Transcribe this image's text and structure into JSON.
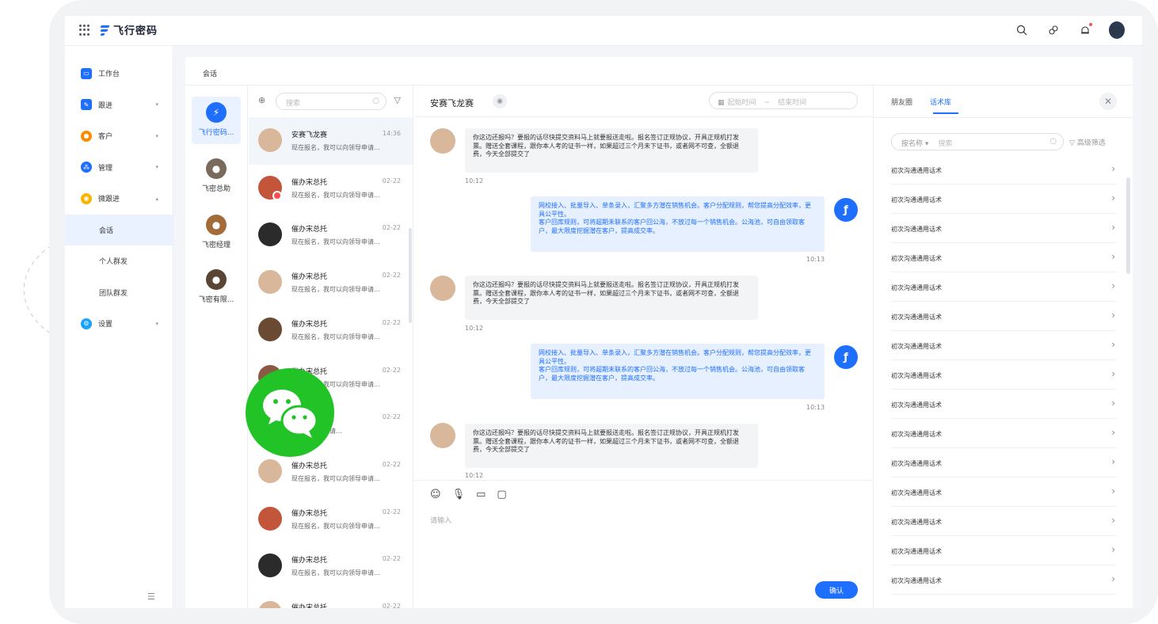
{
  "app": {
    "logo_text": "飞行密码"
  },
  "topbar": {
    "icons": [
      "search-icon",
      "link-icon",
      "bell-icon",
      "user-avatar"
    ]
  },
  "sidebar": {
    "items": [
      {
        "label": "工作台",
        "icon": "workbench-icon",
        "color": "#1f6fff"
      },
      {
        "label": "跟进",
        "icon": "followup-icon",
        "color": "#1f6fff",
        "arrow": "▾"
      },
      {
        "label": "客户",
        "icon": "customer-icon",
        "color": "#ff8a00",
        "arrow": "▾"
      },
      {
        "label": "管理",
        "icon": "manage-icon",
        "color": "#1f6fff",
        "arrow": "▾"
      },
      {
        "label": "微跟进",
        "icon": "wechat-follow-icon",
        "color": "#f7b500",
        "arrow": "▴"
      }
    ],
    "sub_items": [
      {
        "label": "会话",
        "active": true
      },
      {
        "label": "个人群发"
      },
      {
        "label": "团队群发"
      }
    ],
    "settings": {
      "label": "设置",
      "icon": "settings-icon",
      "color": "#1aa2ff",
      "arrow": "▾"
    }
  },
  "page": {
    "title": "会话"
  },
  "accounts": [
    {
      "name": "飞行密码...",
      "active": true,
      "color": "#1f6fff",
      "initial": "F"
    },
    {
      "name": "飞密总助",
      "color": "#7a6a5c"
    },
    {
      "name": "飞密经理",
      "color": "#a36b3a"
    },
    {
      "name": "飞密有限...",
      "color": "#5a4434"
    }
  ],
  "conv_search": {
    "placeholder": "搜索"
  },
  "conversations": [
    {
      "name": "安赛飞龙赛",
      "time": "14:36",
      "msg": "现在报名，我可以向领导申请...",
      "active": true,
      "color": "#d9b79a"
    },
    {
      "name": "催办宋总托",
      "time": "02-22",
      "msg": "现在报名，我可以向领导申请...",
      "color": "#c2553a",
      "badge": true
    },
    {
      "name": "催办宋总托",
      "time": "02-22",
      "msg": "现在报名，我可以向领导申请...",
      "color": "#2b2b2b"
    },
    {
      "name": "催办宋总托",
      "time": "02-22",
      "msg": "现在报名，我可以向领导申请...",
      "color": "#d9b79a"
    },
    {
      "name": "催办宋总托",
      "time": "02-22",
      "msg": "现在报名，我可以向领导申请...",
      "color": "#6b4a33"
    },
    {
      "name": "催办宋总托",
      "time": "02-22",
      "msg": "现在报名，我可以向领导申请...",
      "color": "#8a5a44"
    },
    {
      "name": "",
      "time": "02-22",
      "msg": "可以向领导申请...",
      "color": "#c59a7a"
    },
    {
      "name": "催办宋总托",
      "time": "02-22",
      "msg": "现在报名，我可以向领导申请...",
      "color": "#d9b79a"
    },
    {
      "name": "催办宋总托",
      "time": "02-22",
      "msg": "现在报名，我可以向领导申请...",
      "color": "#c2553a"
    },
    {
      "name": "催办宋总托",
      "time": "02-22",
      "msg": "现在报名，我可以向领导申请...",
      "color": "#2b2b2b"
    },
    {
      "name": "催办宋总托",
      "time": "02-22",
      "msg": "",
      "color": "#d9b79a"
    }
  ],
  "chat": {
    "title": "安赛飞龙赛",
    "date_start": "起始时间",
    "date_sep": "~",
    "date_end": "结束时间",
    "msg_left_1": "你这边还报吗？要报的话尽快提交资料马上就要报送走啦。报名签订正规协议，开具正规机打发票。赠送全套课程，跟你本人考的证书一样，如果超过三个月未下证书，或者网不可查，全额退费，今天全部提交了",
    "msg_right_1a": "网校接入、批量导入、单条录入，汇聚多方潜在销售机会。客户分配规则，帮您提高分配效率，更具公平性。",
    "msg_right_1b": "客户回库规则，可将超期未联系的客户回公海，不放过每一个销售机会。公海池，可自由领取客户，最大限度挖掘潜在客户，提高成交率。",
    "t1": "10:12",
    "t2": "10:13",
    "t3": "10:12",
    "t4": "10:13",
    "t5": "10:12",
    "input_placeholder": "请输入",
    "tools": [
      "smile-icon",
      "mic-icon",
      "folder-icon",
      "chat-icon"
    ],
    "confirm": "确认"
  },
  "right_panel": {
    "tabs": [
      {
        "label": "朋友圈"
      },
      {
        "label": "话术库",
        "active": true
      }
    ],
    "search_type": "按名称 ▾",
    "search_placeholder": "搜索",
    "filter": "▽ 高级筛选",
    "items": [
      "初次沟通通用话术",
      "初次沟通通用话术",
      "初次沟通通用话术",
      "初次沟通通用话术",
      "初次沟通通用话术",
      "初次沟通通用话术",
      "初次沟通通用话术",
      "初次沟通通用话术",
      "初次沟通通用话术",
      "初次沟通通用话术",
      "初次沟通通用话术",
      "初次沟通通用话术",
      "初次沟通通用话术",
      "初次沟通通用话术",
      "初次沟通通用话术"
    ]
  },
  "colors": {
    "accent": "#1f6fff",
    "wechat": "#22c326"
  }
}
